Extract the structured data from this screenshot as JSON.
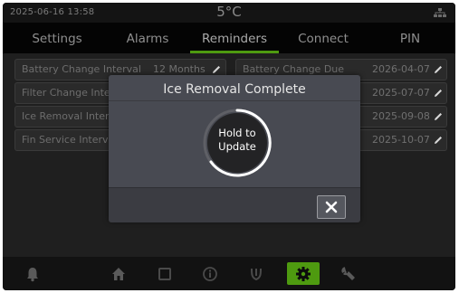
{
  "status": {
    "datetime": "2025-06-16   13:58",
    "temperature": "5°C",
    "network_icon": "network-icon"
  },
  "tabs": [
    {
      "label": "Settings"
    },
    {
      "label": "Alarms"
    },
    {
      "label": "Reminders"
    },
    {
      "label": "Connect"
    },
    {
      "label": "PIN"
    }
  ],
  "active_tab": "Reminders",
  "reminders": {
    "left": [
      {
        "label": "Battery Change Interval",
        "value": "12 Months"
      },
      {
        "label": "Filter Change Inte",
        "value": ""
      },
      {
        "label": "Ice Removal Inter",
        "value": ""
      },
      {
        "label": "Fin Service Interv",
        "value": ""
      }
    ],
    "right": [
      {
        "label": "Battery Change Due",
        "value": "2026-04-07"
      },
      {
        "label": "",
        "value": "2025-07-07"
      },
      {
        "label": "",
        "value": "2025-09-08"
      },
      {
        "label": "",
        "value": "2025-10-07"
      }
    ]
  },
  "modal": {
    "title": "Ice Removal Complete",
    "hold_line1": "Hold to",
    "hold_line2": "Update",
    "close_icon": "close-icon"
  },
  "bottom_nav": [
    {
      "icon": "bell-icon"
    },
    {
      "icon": "home-icon"
    },
    {
      "icon": "square-icon"
    },
    {
      "icon": "info-icon"
    },
    {
      "icon": "defrost-icon"
    },
    {
      "icon": "gear-icon",
      "active": true
    },
    {
      "icon": "wrench-icon"
    }
  ],
  "colors": {
    "accent": "#4e9a10",
    "modal": "#484a52",
    "background": "#050505"
  }
}
